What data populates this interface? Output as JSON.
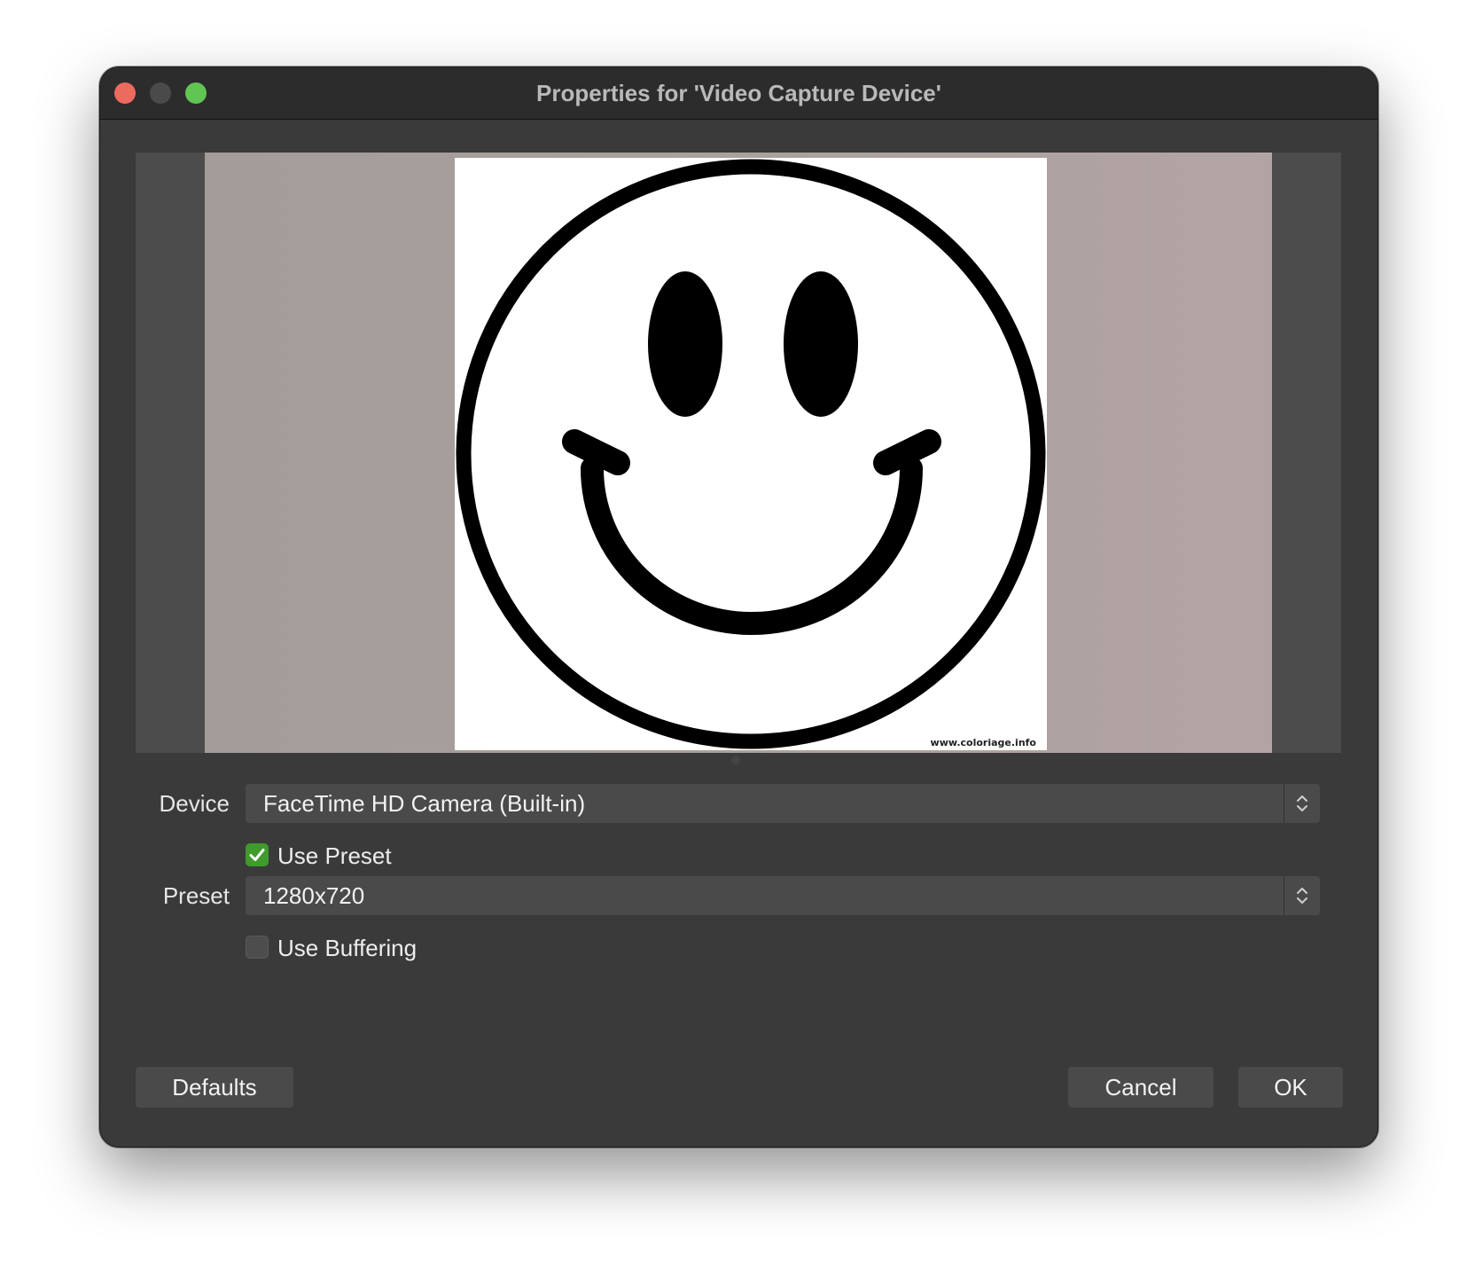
{
  "window": {
    "title": "Properties for 'Video Capture Device'"
  },
  "preview": {
    "watermark": "www.coloriage.info"
  },
  "form": {
    "device_label": "Device",
    "device_value": "FaceTime HD Camera (Built-in)",
    "use_preset_label": "Use Preset",
    "use_preset_checked": true,
    "preset_label": "Preset",
    "preset_value": "1280x720",
    "use_buffering_label": "Use Buffering",
    "use_buffering_checked": false
  },
  "buttons": {
    "defaults": "Defaults",
    "cancel": "Cancel",
    "ok": "OK"
  },
  "colors": {
    "window_bg": "#3a3a3a",
    "titlebar_bg": "#2c2c2c",
    "close": "#ed6a5e",
    "minimize_disabled": "#4a4a4a",
    "zoom": "#61c554",
    "checkbox_checked": "#3f9b2b"
  }
}
